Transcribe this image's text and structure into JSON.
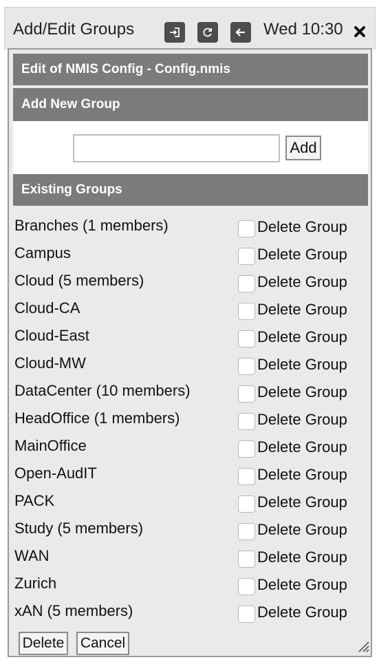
{
  "window": {
    "title": "Add/Edit Groups",
    "clock": "Wed 10:30",
    "buttons": [
      "login-icon",
      "refresh-icon",
      "back-arrow-icon",
      "close-icon"
    ]
  },
  "sections": {
    "config_header": "Edit of NMIS Config - Config.nmis",
    "add_header": "Add New Group",
    "existing_header": "Existing Groups"
  },
  "add_form": {
    "input_value": "",
    "add_label": "Add"
  },
  "groups": [
    {
      "name": "Branches (1 members)",
      "delete_label": "Delete Group"
    },
    {
      "name": "Campus",
      "delete_label": "Delete Group"
    },
    {
      "name": "Cloud (5 members)",
      "delete_label": "Delete Group"
    },
    {
      "name": "Cloud-CA",
      "delete_label": "Delete Group"
    },
    {
      "name": "Cloud-East",
      "delete_label": "Delete Group"
    },
    {
      "name": "Cloud-MW",
      "delete_label": "Delete Group"
    },
    {
      "name": "DataCenter (10 members)",
      "delete_label": "Delete Group"
    },
    {
      "name": "HeadOffice (1 members)",
      "delete_label": "Delete Group"
    },
    {
      "name": "MainOffice",
      "delete_label": "Delete Group"
    },
    {
      "name": "Open-AudIT",
      "delete_label": "Delete Group"
    },
    {
      "name": "PACK",
      "delete_label": "Delete Group"
    },
    {
      "name": "Study (5 members)",
      "delete_label": "Delete Group"
    },
    {
      "name": "WAN",
      "delete_label": "Delete Group"
    },
    {
      "name": "Zurich",
      "delete_label": "Delete Group"
    },
    {
      "name": "xAN (5 members)",
      "delete_label": "Delete Group"
    }
  ],
  "footer": {
    "delete_label": "Delete",
    "cancel_label": "Cancel"
  }
}
